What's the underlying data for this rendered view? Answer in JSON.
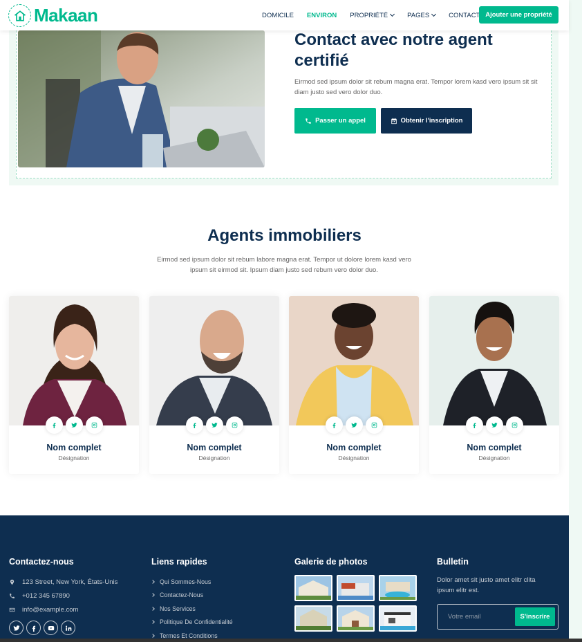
{
  "brand": {
    "name": "Makaan"
  },
  "nav": {
    "items": [
      {
        "label": "DOMICILE",
        "dropdown": false,
        "active": false
      },
      {
        "label": "ENVIRON",
        "dropdown": false,
        "active": true
      },
      {
        "label": "PROPRIÉTÉ",
        "dropdown": true,
        "active": false
      },
      {
        "label": "PAGES",
        "dropdown": true,
        "active": false
      },
      {
        "label": "CONTACT",
        "dropdown": false,
        "active": false
      }
    ],
    "cta_label": "Ajouter une propriété"
  },
  "contact": {
    "title": "Contact avec notre agent certifié",
    "text": "Eirmod sed ipsum dolor sit rebum magna erat. Tempor lorem kasd vero ipsum sit sit diam justo sed vero dolor duo.",
    "call_label": "Passer un appel",
    "signup_label": "Obtenir l'inscription"
  },
  "agents": {
    "title": "Agents immobiliers",
    "text": "Eirmod sed ipsum dolor sit rebum labore magna erat. Tempor ut dolore lorem kasd vero ipsum sit eirmod sit. Ipsum diam justo sed rebum vero dolor duo.",
    "cards": [
      {
        "name": "Nom complet",
        "role": "Désignation"
      },
      {
        "name": "Nom complet",
        "role": "Désignation"
      },
      {
        "name": "Nom complet",
        "role": "Désignation"
      },
      {
        "name": "Nom complet",
        "role": "Désignation"
      }
    ]
  },
  "footer": {
    "contact_title": "Contactez-nous",
    "address": "123 Street, New York, États-Unis",
    "phone": "+012 345 67890",
    "email": "info@example.com",
    "links_title": "Liens rapides",
    "links": [
      "Qui Sommes-Nous",
      "Contactez-Nous",
      "Nos Services",
      "Politique De Confidentialité",
      "Termes Et Conditions"
    ],
    "gallery_title": "Galerie de photos",
    "newsletter_title": "Bulletin",
    "newsletter_text": "Dolor amet sit justo amet elitr clita ipsum elitr est.",
    "newsletter_placeholder": "Votre email",
    "newsletter_button": "S'inscrire"
  },
  "colors": {
    "primary": "#00b98e",
    "dark": "#0e2e50",
    "light": "#eff9f4"
  }
}
